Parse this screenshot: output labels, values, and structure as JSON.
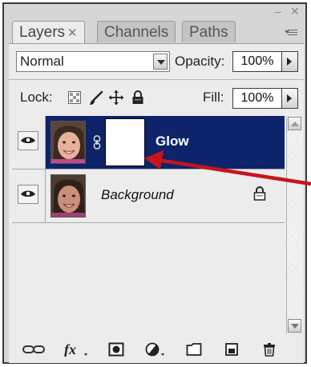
{
  "window": {
    "minimize_glyph": "–",
    "close_glyph": "✕"
  },
  "tabs": [
    {
      "label": "Layers",
      "close_glyph": "✕",
      "active": true
    },
    {
      "label": "Channels",
      "active": false
    },
    {
      "label": "Paths",
      "active": false
    }
  ],
  "toolbar": {
    "blend_mode": "Normal",
    "opacity_label": "Opacity:",
    "opacity_value": "100%",
    "lock_label": "Lock:",
    "fill_label": "Fill:",
    "fill_value": "100%"
  },
  "layers": [
    {
      "name": "Glow",
      "visible": true,
      "selected": true,
      "has_mask": true,
      "locked": false
    },
    {
      "name": "Background",
      "visible": true,
      "selected": false,
      "has_mask": false,
      "locked": true
    }
  ],
  "bottom_icons": [
    "link-layers-icon",
    "layer-style-icon",
    "add-mask-icon",
    "adjustment-layer-icon",
    "new-group-icon",
    "new-layer-icon",
    "delete-layer-icon"
  ],
  "colors": {
    "selection": "#0d246a",
    "annotation_arrow": "#c8141c"
  }
}
